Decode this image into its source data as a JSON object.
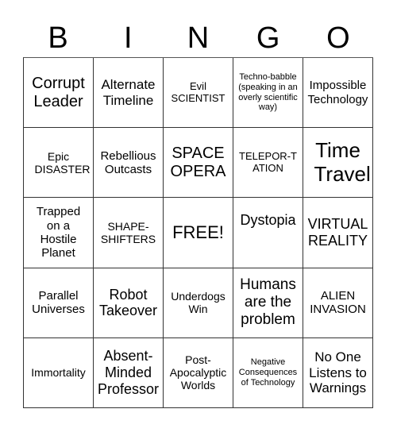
{
  "header": {
    "letters": [
      "B",
      "I",
      "N",
      "G",
      "O"
    ]
  },
  "cells": [
    "Corrupt Leader",
    "Alternate Timeline",
    "Evil SCIENTIST",
    "Techno-babble (speaking in an overly scientific way)",
    "Impossible Technology",
    "Epic DISASTER",
    "Rebellious Outcasts",
    "SPACE OPERA",
    "TELEPOR-TATION",
    "Time Travel",
    "Trapped on a Hostile Planet",
    "SHAPE-SHIFTERS",
    "FREE!",
    "Dystopia",
    "VIRTUAL REALITY",
    "Parallel Universes",
    "Robot Takeover",
    "Underdogs Win",
    "Humans are the problem",
    "ALIEN INVASION",
    "Immortality",
    "Absent-Minded Professor",
    "Post-Apocalyptic Worlds",
    "Negative Consequences of Technology",
    "No One Listens to Warnings"
  ]
}
